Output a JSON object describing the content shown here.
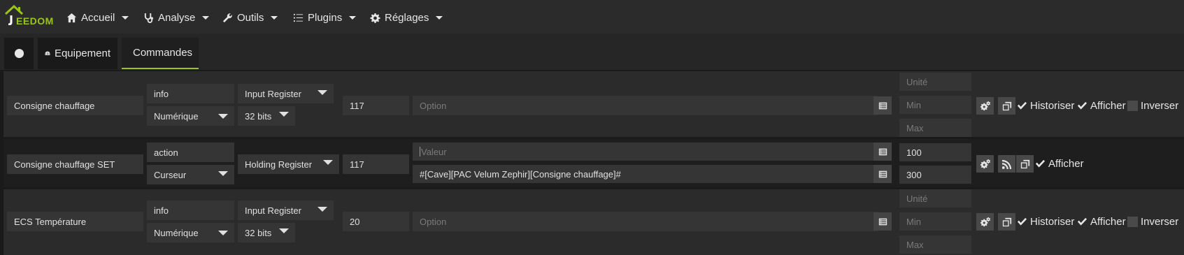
{
  "navbar": {
    "logo_j": "J",
    "logo_rest": "EEDOM",
    "items": [
      {
        "label": "Accueil",
        "icon": "home-icon"
      },
      {
        "label": "Analyse",
        "icon": "stethoscope-icon"
      },
      {
        "label": "Outils",
        "icon": "wrench-icon"
      },
      {
        "label": "Plugins",
        "icon": "list-icon"
      },
      {
        "label": "Réglages",
        "icon": "gear-icon"
      }
    ]
  },
  "tabs": [
    {
      "label": "",
      "icon": "back-arrow-icon"
    },
    {
      "label": "Equipement",
      "icon": "dashboard-icon"
    },
    {
      "label": "Commandes",
      "icon": "list-alt-icon"
    }
  ],
  "commands": [
    {
      "name": "Consigne chauffage",
      "type": "info",
      "subtype": "Numérique",
      "register": "Input Register",
      "format": "32 bits",
      "address": "117",
      "option_placeholder": "Option",
      "unit_placeholder": "Unité",
      "min_placeholder": "Min",
      "max_placeholder": "Max",
      "historiser": "Historiser",
      "afficher": "Afficher",
      "inverser": "Inverser"
    },
    {
      "name": "Consigne chauffage SET",
      "type": "action",
      "subtype": "Curseur",
      "register": "Holding Register",
      "address": "117",
      "value_placeholder": "Valeur",
      "value_cmd": "#[Cave][PAC Velum Zephir][Consigne chauffage]#",
      "min": "100",
      "max": "300",
      "afficher": "Afficher"
    },
    {
      "name": "ECS Température",
      "type": "info",
      "subtype": "Numérique",
      "register": "Input Register",
      "format": "32 bits",
      "address": "20",
      "option_placeholder": "Option",
      "unit_placeholder": "Unité",
      "min_placeholder": "Min",
      "max_placeholder": "Max",
      "historiser": "Historiser",
      "afficher": "Afficher",
      "inverser": "Inverser"
    }
  ],
  "colors": {
    "accent": "#9ac31c",
    "background": "#1a1a1a",
    "row": "#2b2b2b"
  }
}
